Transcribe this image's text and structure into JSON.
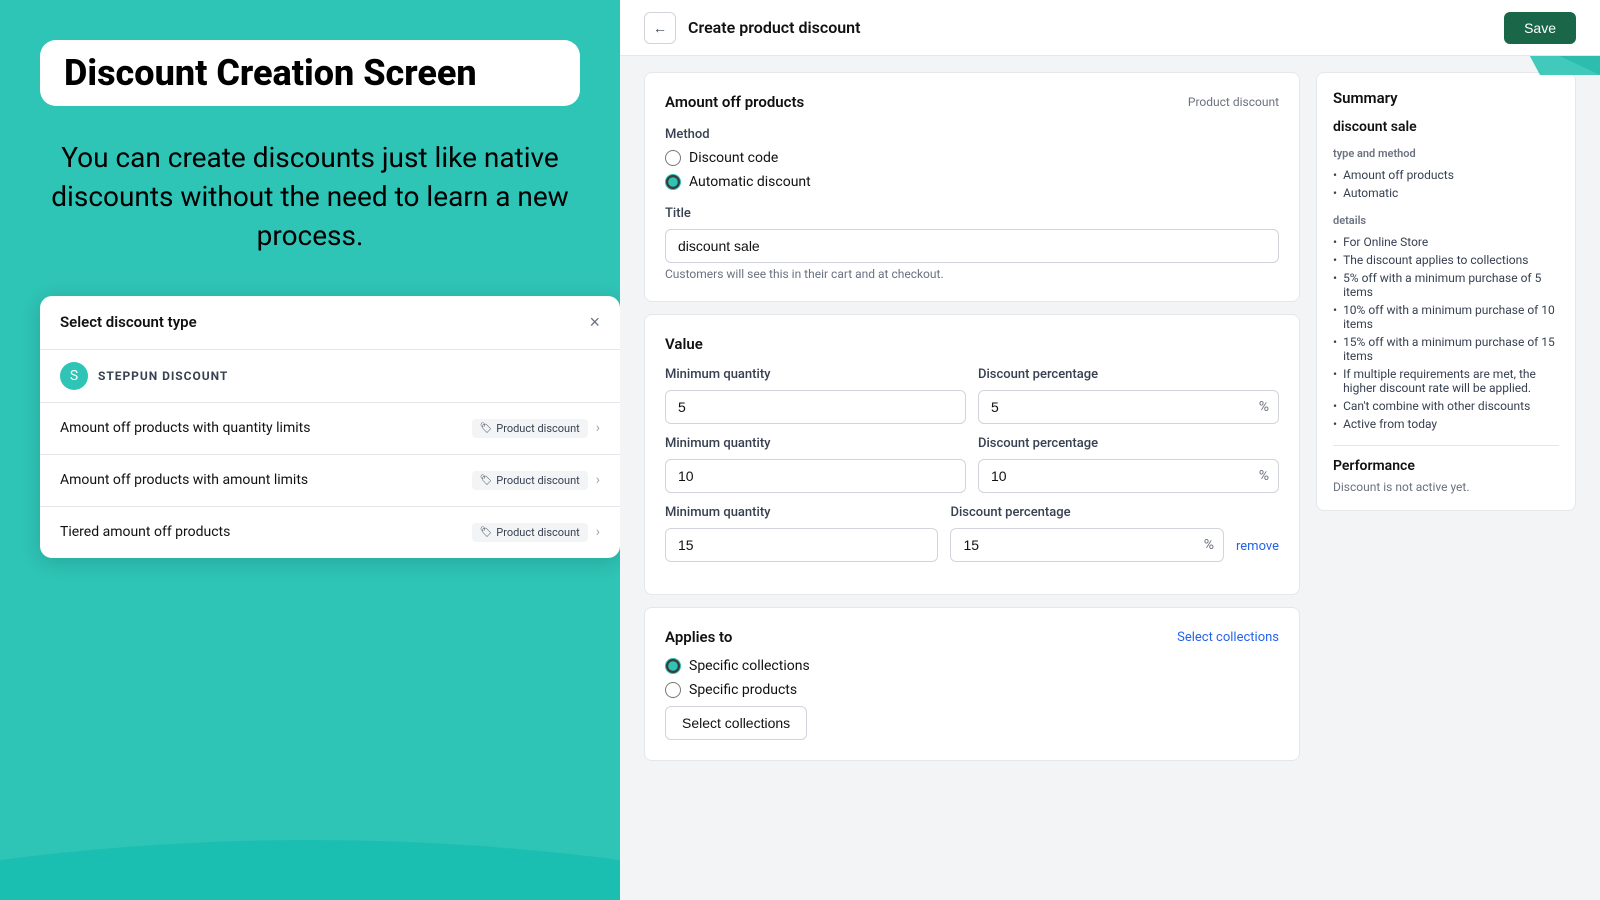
{
  "left": {
    "title": "Discount Creation Screen",
    "subtitle": "You can create discounts just like native discounts without the need to learn a new process.",
    "modal": {
      "title": "Select discount type",
      "close": "×",
      "brand_icon": "S",
      "brand_name": "STEPPUN DISCOUNT",
      "items": [
        {
          "label": "Amount off products with quantity limits",
          "badge": "Product discount"
        },
        {
          "label": "Amount off products with amount limits",
          "badge": "Product discount"
        },
        {
          "label": "Tiered amount off products",
          "badge": "Product discount"
        }
      ]
    }
  },
  "header": {
    "back_icon": "←",
    "title": "Create product discount",
    "save_label": "Save"
  },
  "form": {
    "amount_off": {
      "section_title": "Amount off products",
      "badge": "Product discount"
    },
    "method": {
      "label": "Method",
      "options": [
        {
          "label": "Discount code",
          "selected": false
        },
        {
          "label": "Automatic discount",
          "selected": true
        }
      ]
    },
    "title_field": {
      "label": "Title",
      "value": "discount sale",
      "hint": "Customers will see this in their cart and at checkout."
    },
    "value": {
      "section_title": "Value",
      "rows": [
        {
          "min_qty_label": "Minimum quantity",
          "min_qty_value": "5",
          "discount_pct_label": "Discount percentage",
          "discount_pct_value": "5",
          "suffix": "%",
          "show_remove": false
        },
        {
          "min_qty_label": "Minimum quantity",
          "min_qty_value": "10",
          "discount_pct_label": "Discount percentage",
          "discount_pct_value": "10",
          "suffix": "%",
          "show_remove": false
        },
        {
          "min_qty_label": "Minimum quantity",
          "min_qty_value": "15",
          "discount_pct_label": "Discount percentage",
          "discount_pct_value": "15",
          "suffix": "%",
          "show_remove": true,
          "remove_label": "remove"
        }
      ]
    },
    "applies_to": {
      "label": "Applies to",
      "select_link": "Select collections",
      "options": [
        {
          "label": "Specific collections",
          "selected": true
        },
        {
          "label": "Specific products",
          "selected": false
        }
      ],
      "button_label": "Select collections"
    }
  },
  "summary": {
    "title": "Summary",
    "discount_name": "discount sale",
    "type_method_label": "type and method",
    "type_items": [
      "Amount off products",
      "Automatic"
    ],
    "details_label": "details",
    "detail_items": [
      "For Online Store",
      "The discount applies to collections",
      "5% off with a minimum purchase of 5 items",
      "10% off with a minimum purchase of 10 items",
      "15% off with a minimum purchase of 15 items",
      "If multiple requirements are met, the higher discount rate will be applied.",
      "Can't combine with other discounts",
      "Active from today"
    ],
    "performance_title": "Performance",
    "performance_text": "Discount is not active yet."
  }
}
